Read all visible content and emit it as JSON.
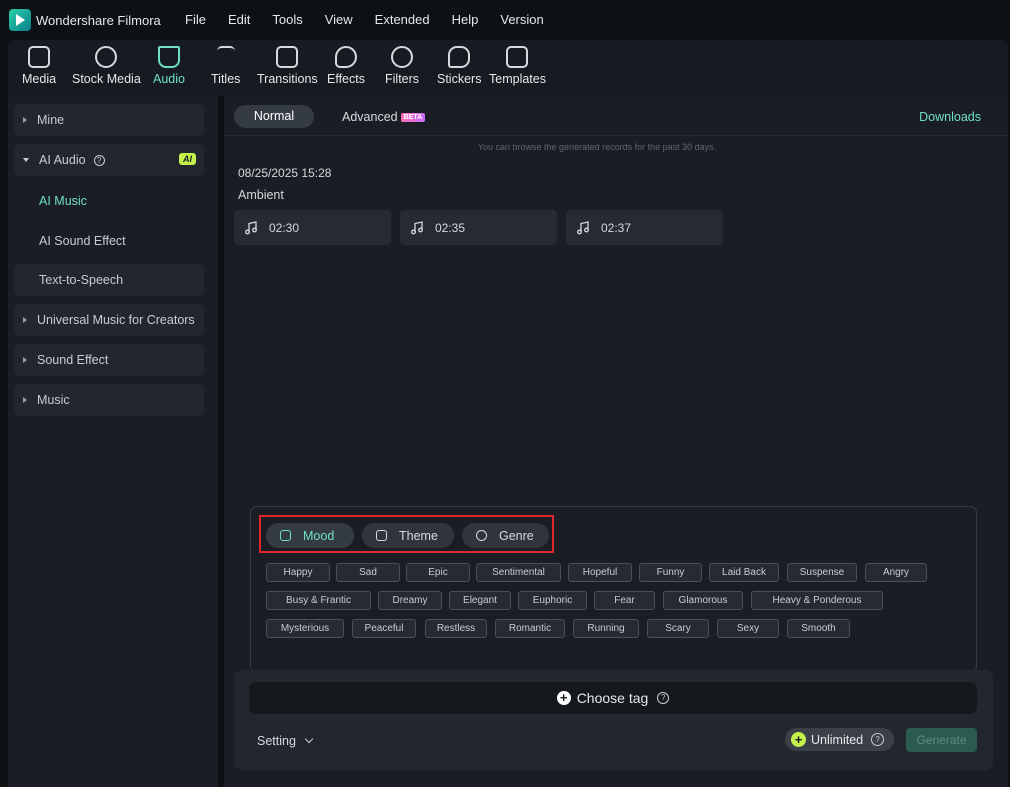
{
  "app": {
    "name": "Wondershare Filmora",
    "menu": [
      "File",
      "Edit",
      "Tools",
      "View",
      "Extended",
      "Help",
      "Version"
    ]
  },
  "toolbar": {
    "items": [
      {
        "label": "Media",
        "icon": "media-icon"
      },
      {
        "label": "Stock Media",
        "icon": "stock-media-icon"
      },
      {
        "label": "Audio",
        "icon": "audio-icon"
      },
      {
        "label": "Titles",
        "icon": "titles-icon"
      },
      {
        "label": "Transitions",
        "icon": "transitions-icon"
      },
      {
        "label": "Effects",
        "icon": "effects-icon"
      },
      {
        "label": "Filters",
        "icon": "filters-icon"
      },
      {
        "label": "Stickers",
        "icon": "stickers-icon"
      },
      {
        "label": "Templates",
        "icon": "templates-icon"
      }
    ],
    "active": "Audio"
  },
  "sidebar": {
    "mine": "Mine",
    "ai_audio": "AI Audio",
    "ai_badge": "AI",
    "ai_music": "AI Music",
    "ai_sound_effect": "AI Sound Effect",
    "text_to_speech": "Text-to-Speech",
    "universal_music": "Universal Music for Creators",
    "sound_effect": "Sound Effect",
    "music": "Music"
  },
  "main": {
    "tab_normal": "Normal",
    "tab_advanced": "Advanced",
    "beta_badge": "BETA",
    "downloads": "Downloads",
    "notice": "You can browse the generated records for the past 30 days.",
    "record_date": "08/25/2025 15:28",
    "record_name": "Ambient",
    "tracks": [
      "02:30",
      "02:35",
      "02:37"
    ]
  },
  "tags": {
    "categories": [
      "Mood",
      "Theme",
      "Genre"
    ],
    "active_category": "Mood",
    "rows": [
      [
        "Happy",
        "Sad",
        "Epic",
        "Sentimental",
        "Hopeful",
        "Funny",
        "Laid Back",
        "Suspense",
        "Angry"
      ],
      [
        "Busy & Frantic",
        "Dreamy",
        "Elegant",
        "Euphoric",
        "Fear",
        "Glamorous",
        "Heavy & Ponderous"
      ],
      [
        "Mysterious",
        "Peaceful",
        "Restless",
        "Romantic",
        "Running",
        "Scary",
        "Sexy",
        "Smooth"
      ]
    ]
  },
  "bottom": {
    "choose_tag": "Choose tag",
    "setting": "Setting",
    "unlimited": "Unlimited",
    "generate": "Generate"
  },
  "colors": {
    "accent": "#6fe0c3",
    "ai_badge": "#c5f24a",
    "highlight_box": "#e0262e"
  }
}
